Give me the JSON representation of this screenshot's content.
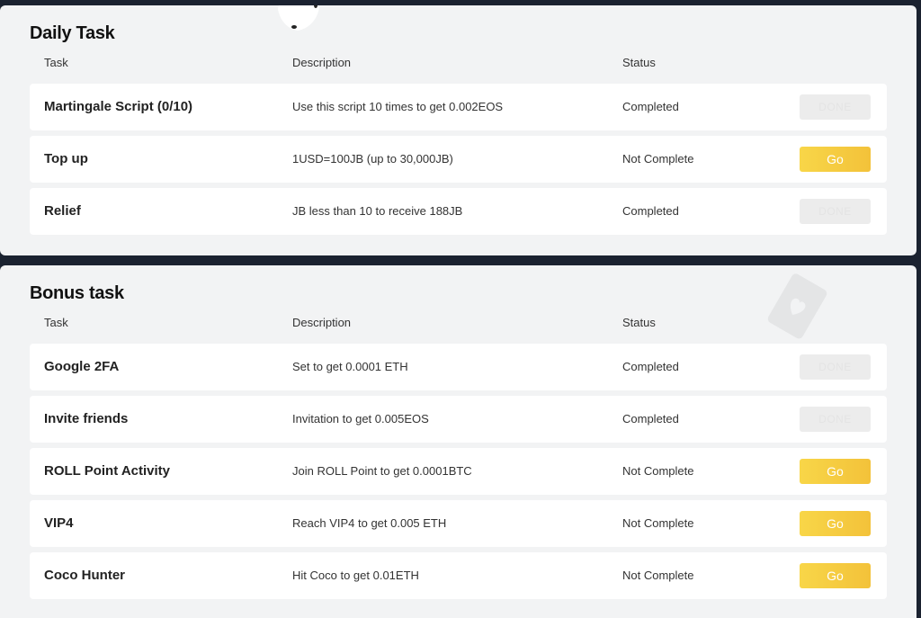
{
  "daily": {
    "title": "Daily Task",
    "headers": {
      "task": "Task",
      "description": "Description",
      "status": "Status"
    },
    "rows": [
      {
        "task": "Martingale Script (0/10)",
        "description": "Use this script 10 times to get 0.002EOS",
        "status": "Completed",
        "action": "DONE"
      },
      {
        "task": "Top up",
        "description": "1USD=100JB (up to 30,000JB)",
        "status": "Not Complete",
        "action": "Go"
      },
      {
        "task": "Relief",
        "description": "JB less than 10 to receive 188JB",
        "status": "Completed",
        "action": "DONE"
      }
    ]
  },
  "bonus": {
    "title": "Bonus task",
    "headers": {
      "task": "Task",
      "description": "Description",
      "status": "Status"
    },
    "rows": [
      {
        "task": "Google 2FA",
        "description": "Set to get 0.0001 ETH",
        "status": "Completed",
        "action": "DONE"
      },
      {
        "task": "Invite friends",
        "description": "Invitation to get 0.005EOS",
        "status": "Completed",
        "action": "DONE"
      },
      {
        "task": "ROLL Point Activity",
        "description": "Join ROLL Point to get 0.0001BTC",
        "status": "Not Complete",
        "action": "Go"
      },
      {
        "task": "VIP4",
        "description": "Reach VIP4 to get 0.005 ETH",
        "status": "Not Complete",
        "action": "Go"
      },
      {
        "task": "Coco Hunter",
        "description": "Hit Coco to get 0.01ETH",
        "status": "Not Complete",
        "action": "Go"
      }
    ]
  },
  "icons": {
    "dice": "dice-icon",
    "card": "playing-card-icon"
  },
  "colors": {
    "accent": "#f5c93f",
    "done_bg": "#ececec",
    "background": "#1b2230",
    "card": "#f2f3f4"
  }
}
